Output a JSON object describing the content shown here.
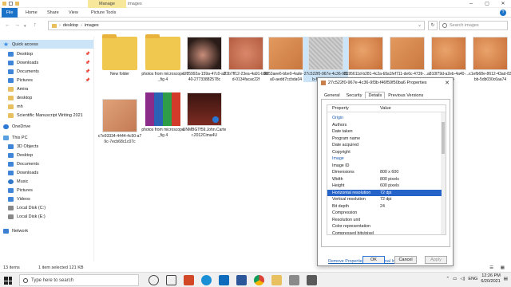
{
  "window": {
    "manage_tab": "Manage",
    "title": "images"
  },
  "ribbon": {
    "tabs": [
      "File",
      "Home",
      "Share",
      "View",
      "Picture Tools"
    ],
    "help": "?"
  },
  "address": {
    "crumbs": [
      "desktop",
      "images"
    ],
    "search_placeholder": "Search images"
  },
  "sidebar": {
    "items": [
      {
        "label": "Quick access",
        "icon": "star-icon",
        "pinned": false
      },
      {
        "label": "Desktop",
        "icon": "desktop-icon",
        "pinned": true
      },
      {
        "label": "Downloads",
        "icon": "downloads-icon",
        "pinned": true
      },
      {
        "label": "Documents",
        "icon": "documents-icon",
        "pinned": true
      },
      {
        "label": "Pictures",
        "icon": "pictures-icon",
        "pinned": true
      },
      {
        "label": "Amira",
        "icon": "folder-icon",
        "pinned": false
      },
      {
        "label": "desktop",
        "icon": "folder-icon",
        "pinned": false
      },
      {
        "label": "mh",
        "icon": "folder-icon",
        "pinned": false
      },
      {
        "label": "Scientific Manuscript Writing 2021",
        "icon": "folder-icon",
        "pinned": false
      },
      {
        "label": "OneDrive",
        "icon": "cloud-icon",
        "pinned": false
      },
      {
        "label": "This PC",
        "icon": "pc-icon",
        "pinned": false
      },
      {
        "label": "3D Objects",
        "icon": "objects-icon",
        "pinned": false
      },
      {
        "label": "Desktop",
        "icon": "desktop-icon",
        "pinned": false
      },
      {
        "label": "Documents",
        "icon": "documents-icon",
        "pinned": false
      },
      {
        "label": "Downloads",
        "icon": "downloads-icon",
        "pinned": false
      },
      {
        "label": "Music",
        "icon": "music-icon",
        "pinned": false
      },
      {
        "label": "Pictures",
        "icon": "pictures-icon",
        "pinned": false
      },
      {
        "label": "Videos",
        "icon": "videos-icon",
        "pinned": false
      },
      {
        "label": "Local Disk (C:)",
        "icon": "drive-icon",
        "pinned": false
      },
      {
        "label": "Local Disk (E:)",
        "icon": "drive-icon",
        "pinned": false
      },
      {
        "label": "Network",
        "icon": "network-icon",
        "pinned": false
      }
    ]
  },
  "files": [
    {
      "label": "New folder",
      "kind": "folder"
    },
    {
      "label": "photos from microscope_fig 4",
      "kind": "folder"
    },
    {
      "label": "1f85992a-159a-47c0-a240-27733882578c",
      "kind": "dark"
    },
    {
      "label": "03b7ff12-23ea-4a91-b99d-0134facac22f",
      "kind": "skin2"
    },
    {
      "label": "8d53aee6-bbe0-4ade-a3a0-aedd7ccbda04",
      "kind": "skin3"
    },
    {
      "label": "27c522f0-967e-4c36-9f3b-f46f59f50ba6",
      "kind": "gray",
      "selected": true
    },
    {
      "label": "3195611d-b281-4c2a-b5db-78ee...",
      "kind": "skin1"
    },
    {
      "label": "a1fef711-de6c-4739-...",
      "kind": "skin3"
    },
    {
      "label": "a810f79d-a2eb-4a40-...-49654",
      "kind": "skin1"
    },
    {
      "label": "c1efb68e-8612-43ad-83bb-5db030c6aa74",
      "kind": "skin1"
    },
    {
      "label": "c7e93334-4444-4c50-a79c-7ecb68c1c07c",
      "kind": "skin4"
    },
    {
      "label": "photos from microscope_fig 4",
      "kind": "rar"
    },
    {
      "label": "UNMBGTf59.John.Carter.2012Cima4U",
      "kind": "video"
    }
  ],
  "dialog": {
    "title": "27c522f0-967e-4c36-9f3b-f46f59f50ba6 Properties",
    "close": "✕",
    "tabs": [
      "General",
      "Security",
      "Details",
      "Previous Versions"
    ],
    "active_tab": "Details",
    "columns": [
      "Property",
      "Value"
    ],
    "rows": [
      {
        "k": "Origin",
        "v": "",
        "section": true
      },
      {
        "k": "Authors",
        "v": ""
      },
      {
        "k": "Date taken",
        "v": ""
      },
      {
        "k": "Program name",
        "v": ""
      },
      {
        "k": "Date acquired",
        "v": ""
      },
      {
        "k": "Copyright",
        "v": ""
      },
      {
        "k": "Image",
        "v": "",
        "section": true
      },
      {
        "k": "Image ID",
        "v": ""
      },
      {
        "k": "Dimensions",
        "v": "800 x 600"
      },
      {
        "k": "Width",
        "v": "800 pixels"
      },
      {
        "k": "Height",
        "v": "600 pixels"
      },
      {
        "k": "Horizontal resolution",
        "v": "72 dpi",
        "highlight": true
      },
      {
        "k": "Vertical resolution",
        "v": "72 dpi"
      },
      {
        "k": "Bit depth",
        "v": "24"
      },
      {
        "k": "Compression",
        "v": ""
      },
      {
        "k": "Resolution unit",
        "v": ""
      },
      {
        "k": "Color representation",
        "v": ""
      },
      {
        "k": "Compressed bits/pixel",
        "v": ""
      }
    ],
    "link": "Remove Properties and Personal Information",
    "buttons": {
      "ok": "OK",
      "cancel": "Cancel",
      "apply": "Apply"
    }
  },
  "status": {
    "items": "13 items",
    "selected": "1 item selected  121 KB"
  },
  "taskbar": {
    "search": "Type here to search",
    "lang": "ENG",
    "time": "12:26 PM",
    "date": "6/20/2021"
  }
}
